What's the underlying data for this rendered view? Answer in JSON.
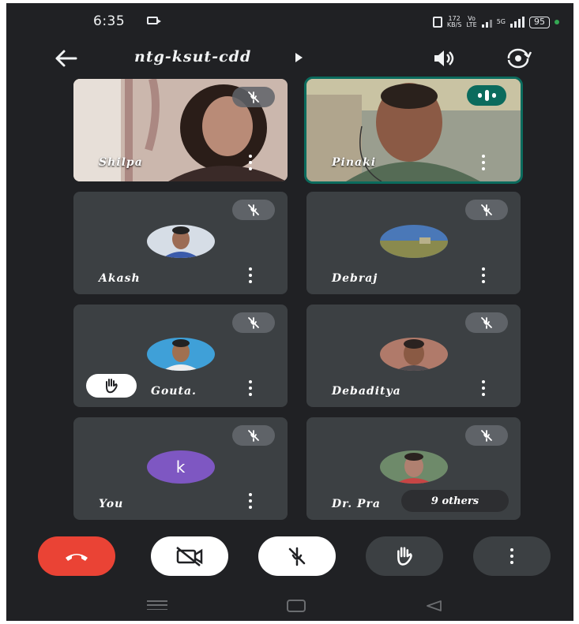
{
  "status": {
    "time": "6:35",
    "net_speed_value": "172",
    "net_speed_unit": "KB/S",
    "volte_top": "Vo",
    "volte_bottom": "LTE",
    "network": "5G",
    "battery": "95"
  },
  "header": {
    "meeting_code": "ntg-ksut-cdd"
  },
  "participants": [
    {
      "name": "Shilpa",
      "muted": true
    },
    {
      "name": "Pinaki",
      "speaking": true
    },
    {
      "name": "Akash",
      "muted": true
    },
    {
      "name": "Debraj",
      "muted": true
    },
    {
      "name": "Gouta.",
      "muted": true,
      "hand_raised": true
    },
    {
      "name": "Debaditya",
      "muted": true
    },
    {
      "name": "You",
      "initial": "k",
      "muted": true
    },
    {
      "name": "Dr. Pra",
      "muted": true
    }
  ],
  "others_chip": "9 others",
  "icons": [
    "back-arrow-icon",
    "play-caret-icon",
    "speaker-icon",
    "switch-camera-icon",
    "mic-off-icon",
    "audio-level-icon",
    "more-vert-icon",
    "raise-hand-icon",
    "end-call-icon",
    "camera-off-icon"
  ],
  "colors": {
    "background": "#202124",
    "tile": "#3c4043",
    "active_speaker": "#0b6b5d",
    "end_call": "#ea4335",
    "avatar_letter_bg": "#7e57c2"
  }
}
